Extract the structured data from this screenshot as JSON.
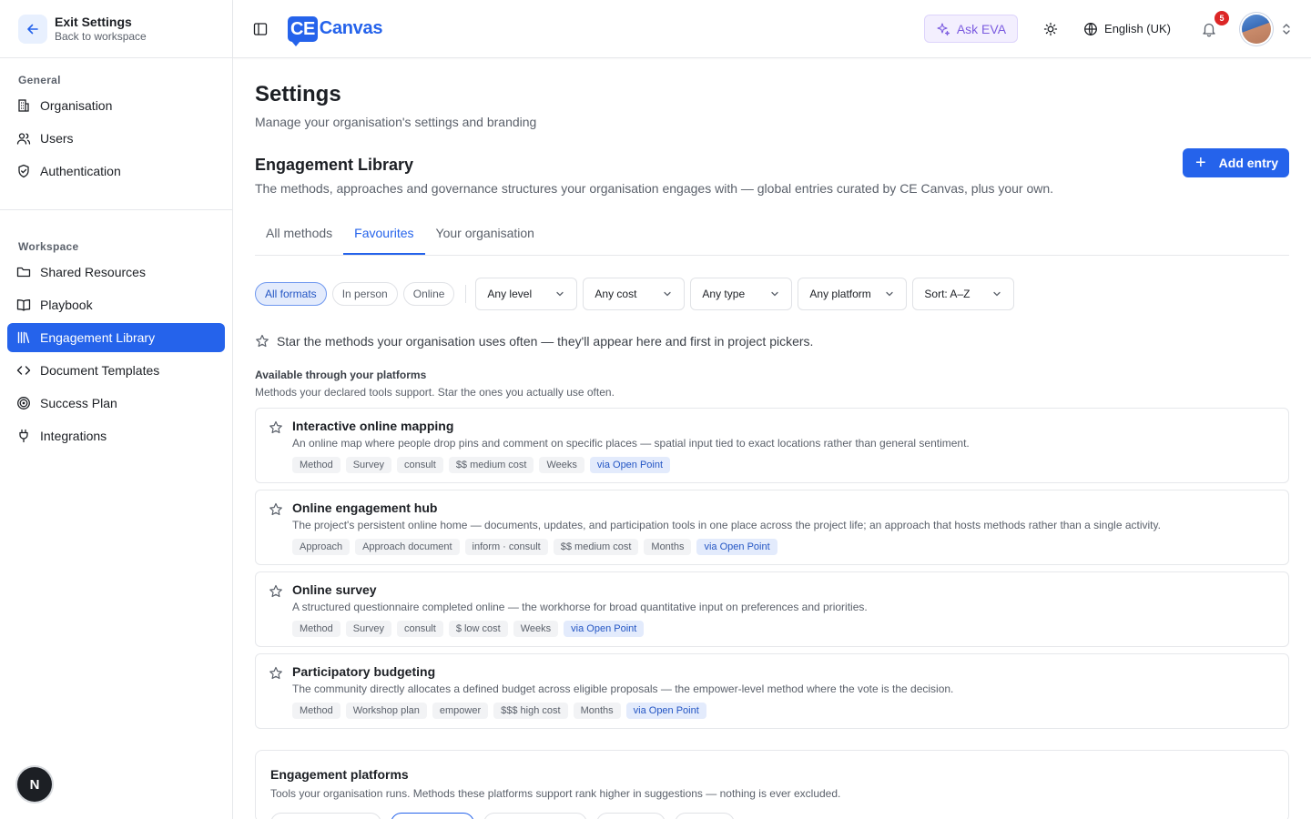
{
  "exit": {
    "title": "Exit Settings",
    "subtitle": "Back to workspace"
  },
  "sidebar": {
    "general_label": "General",
    "general_items": [
      "Organisation",
      "Users",
      "Authentication"
    ],
    "workspace_label": "Workspace",
    "workspace_items": [
      "Shared Resources",
      "Playbook",
      "Engagement Library",
      "Document Templates",
      "Success Plan",
      "Integrations"
    ],
    "active_item": "Engagement Library",
    "avatar_letter": "N"
  },
  "topbar": {
    "logo_mark": "CE",
    "logo_text": "Canvas",
    "ask_label": "Ask EVA",
    "language": "English (UK)",
    "notification_count": "5"
  },
  "page": {
    "title": "Settings",
    "subtitle": "Manage your organisation's settings and branding"
  },
  "section": {
    "title": "Engagement Library",
    "subtitle": "The methods, approaches and governance structures your organisation engages with — global entries curated by CE Canvas, plus your own.",
    "add_label": "Add entry"
  },
  "tabs": [
    "All methods",
    "Favourites",
    "Your organisation"
  ],
  "active_tab": "Favourites",
  "filters": {
    "formats": [
      "All formats",
      "In person",
      "Online"
    ],
    "active_format": "All formats",
    "selects": [
      "Any level",
      "Any cost",
      "Any type",
      "Any platform",
      "Sort: A–Z"
    ]
  },
  "hint": "Star the methods your organisation uses often — they'll appear here and first in project pickers.",
  "available": {
    "title": "Available through your platforms",
    "subtitle": "Methods your declared tools support. Star the ones you actually use often."
  },
  "methods": [
    {
      "title": "Interactive online mapping",
      "description": "An online map where people drop pins and comment on specific places — spatial input tied to exact locations rather than general sentiment.",
      "tags": [
        "Method",
        "Survey",
        "consult",
        "$$ medium cost",
        "Weeks"
      ],
      "platform": "via Open Point"
    },
    {
      "title": "Online engagement hub",
      "description": "The project's persistent online home — documents, updates, and participation tools in one place across the project life; an approach that hosts methods rather than a single activity.",
      "tags": [
        "Approach",
        "Approach document",
        "inform · consult",
        "$$ medium cost",
        "Months"
      ],
      "platform": "via Open Point"
    },
    {
      "title": "Online survey",
      "description": "A structured questionnaire completed online — the workhorse for broad quantitative input on preferences and priorities.",
      "tags": [
        "Method",
        "Survey",
        "consult",
        "$ low cost",
        "Weeks"
      ],
      "platform": "via Open Point"
    },
    {
      "title": "Participatory budgeting",
      "description": "The community directly allocates a defined budget across eligible proposals — the empower-level method where the vote is the decision.",
      "tags": [
        "Method",
        "Workshop plan",
        "empower",
        "$$$ high cost",
        "Months"
      ],
      "platform": "via Open Point"
    }
  ],
  "platforms": {
    "title": "Engagement platforms",
    "subtitle": "Tools your organisation runs. Methods these platforms support rank higher in suggestions — nothing is ever excluded."
  },
  "colors": {
    "accent": "#2563eb",
    "ask": "#7c5ce0",
    "badge": "#dc2626"
  }
}
